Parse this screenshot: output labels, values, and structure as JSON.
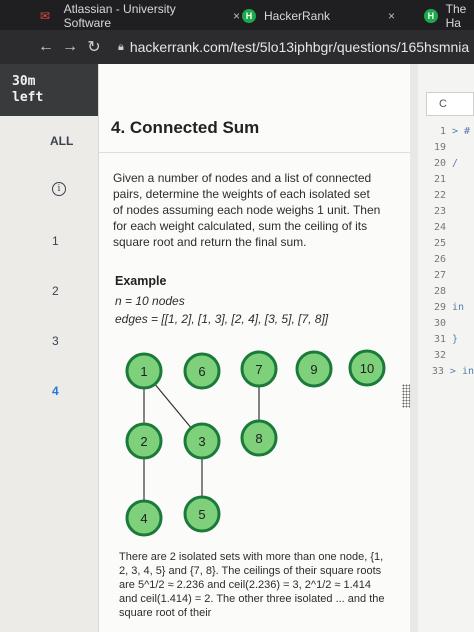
{
  "browser": {
    "tabs": [
      {
        "title": "Atlassian - University Software",
        "close": "×"
      },
      {
        "title": "HackerRank",
        "close": "×"
      },
      {
        "title": "The Ha"
      }
    ],
    "url": "hackerrank.com/test/5lo13iphbgr/questions/165hsmnia"
  },
  "sidebar": {
    "timer_value": "30m",
    "timer_label": "left",
    "items": [
      "ALL",
      "i",
      "1",
      "2",
      "3",
      "4"
    ],
    "active_item": "4"
  },
  "problem": {
    "title": "4. Connected Sum",
    "description": "Given a number of nodes and a list of connected pairs, determine the weights of each isolated set of nodes assuming each node weighs 1 unit. Then for each weight calculated, sum the ceiling of its square root and return the final sum.",
    "example_title": "Example",
    "n_line": "n = 10 nodes",
    "edges_line": "edges = [[1, 2], [1, 3], [2, 4], [3, 5], [7, 8]]",
    "graph_nodes": [
      "1",
      "6",
      "7",
      "9",
      "10",
      "2",
      "3",
      "8",
      "4",
      "5"
    ],
    "after_text": "There are 2 isolated sets with more than one node, {1, 2, 3, 4, 5} and {7, 8}. The ceilings of their square roots are 5^1/2 ≈ 2.236 and ceil(2.236) = 3, 2^1/2 ≈ 1.414 and ceil(1.414) = 2. The other three isolated ... and the square root of their"
  },
  "editor": {
    "language": "C",
    "lines": [
      {
        "num": "1",
        "code": "> #"
      },
      {
        "num": "19",
        "code": ""
      },
      {
        "num": "20",
        "code": "/"
      },
      {
        "num": "21",
        "code": ""
      },
      {
        "num": "22",
        "code": ""
      },
      {
        "num": "23",
        "code": ""
      },
      {
        "num": "24",
        "code": ""
      },
      {
        "num": "25",
        "code": ""
      },
      {
        "num": "26",
        "code": ""
      },
      {
        "num": "27",
        "code": ""
      },
      {
        "num": "28",
        "code": ""
      },
      {
        "num": "29",
        "code": "in"
      },
      {
        "num": "30",
        "code": ""
      },
      {
        "num": "31",
        "code": "}"
      },
      {
        "num": "32",
        "code": ""
      },
      {
        "num": "33",
        "code": "> in"
      }
    ]
  },
  "colors": {
    "node_fill": "#7ed07a",
    "node_stroke": "#1a7a3a",
    "active": "#1c7cd6"
  }
}
